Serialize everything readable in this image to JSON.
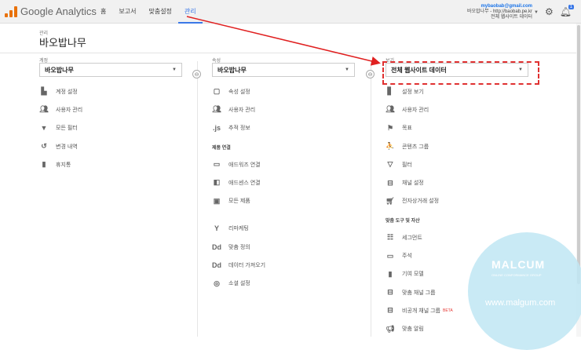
{
  "header": {
    "logo_text": "Google Analytics",
    "nav": [
      "홈",
      "보고서",
      "맞춤설정",
      "관리"
    ],
    "account_email": "mybaobab@gmail.com",
    "account_site": "바오밥나무 - http://baobab.pe.kr",
    "account_view": "전체 웹사이트 데이터",
    "notifications": "1"
  },
  "page": {
    "breadcrumb": "관리",
    "title": "바오밥나무"
  },
  "account_col": {
    "label": "계정",
    "selected": "바오밥나무",
    "items": [
      "계정 설정",
      "사용자 관리",
      "모든 필터",
      "변경 내역",
      "휴지통"
    ]
  },
  "property_col": {
    "label": "속성",
    "selected": "바오밥나무",
    "items": [
      "속성 설정",
      "사용자 관리",
      "추적 정보"
    ],
    "section": "제품 연결",
    "product_items": [
      "애드워즈 연결",
      "애드센스 연결",
      "모든 제품"
    ],
    "more_items": [
      "리마케팅",
      "맞춤 정의",
      "데이터 가져오기",
      "소셜 설정"
    ]
  },
  "view_col": {
    "label": "보기",
    "selected": "전체 웹사이트 데이터",
    "items": [
      "설정 보기",
      "사용자 관리",
      "목표",
      "콘텐츠 그룹",
      "필터",
      "채널 설정",
      "전자상거래 설정"
    ],
    "section": "맞춤 도구 및 자산",
    "tool_items": [
      "세그먼트",
      "주석",
      "기여 모델",
      "맞춤 채널 그룹",
      "비공개 채널 그룹",
      "맞춤 알림"
    ],
    "beta": "BETA"
  },
  "watermark": {
    "title": "MALCUM",
    "sub": "ONLINE CONFORMANCE GROUP",
    "url": "www.malgum.com"
  },
  "colors": {
    "accent": "#3b78e7",
    "arrow": "#e02020",
    "logo": "#e8710a"
  }
}
